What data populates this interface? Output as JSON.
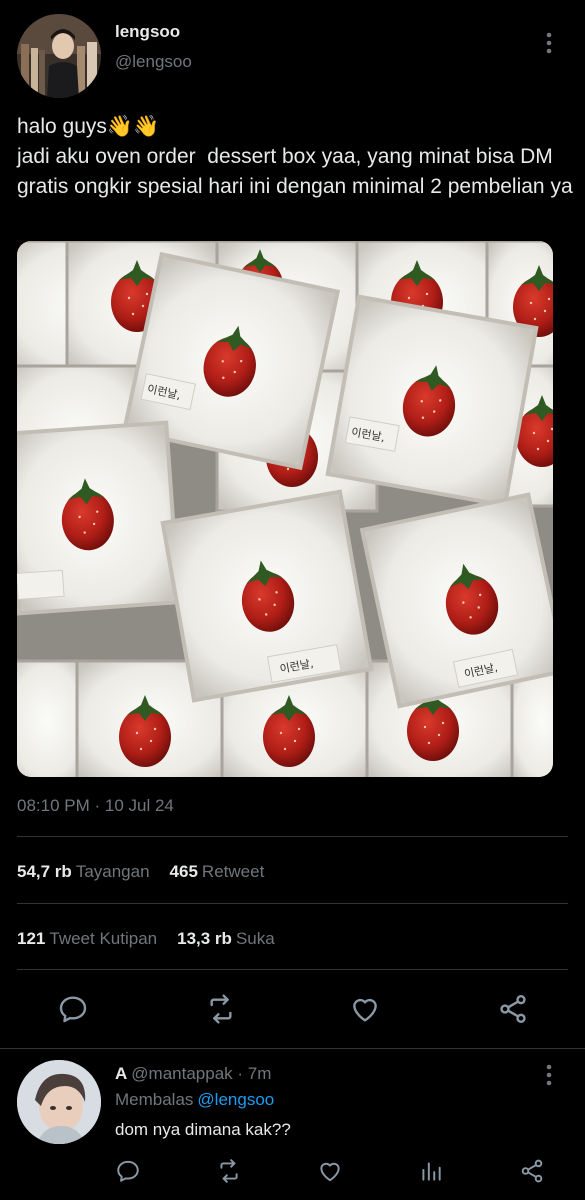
{
  "author": {
    "name": "lengsoo",
    "handle": "@lengsoo"
  },
  "tweet": {
    "text": "halo guys👋👋\njadi aku oven order  dessert box yaa, yang minat bisa DM gratis ongkir spesial hari ini dengan minimal 2 pembelian ya",
    "box_label": "이런날,",
    "timestamp": "08:10 PM · 10 Jul 24"
  },
  "stats": {
    "views_num": "54,7 rb",
    "views_label": "Tayangan",
    "retweets_num": "465",
    "retweets_label": "Retweet",
    "quotes_num": "121",
    "quotes_label": "Tweet Kutipan",
    "likes_num": "13,3 rb",
    "likes_label": "Suka"
  },
  "actions": {
    "icons": [
      "reply-icon",
      "retweet-icon",
      "like-icon",
      "share-icon"
    ]
  },
  "reply": {
    "name": "A",
    "handle_time": "@mantappak · 7m",
    "replying_label": "Membalas",
    "replying_to": "@lengsoo",
    "text": "dom nya dimana kak??"
  },
  "colors": {
    "background": "#000000",
    "text": "#e7e9ea",
    "muted": "#71767b",
    "link": "#1d9bf0",
    "divider": "#2f3336"
  }
}
